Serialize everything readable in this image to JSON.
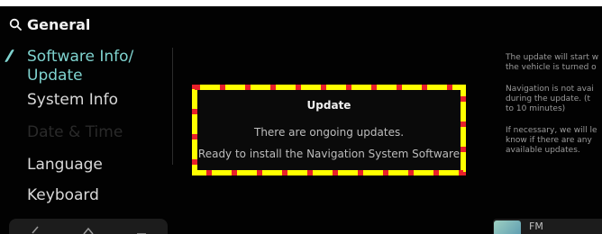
{
  "search": {
    "title": "General"
  },
  "menu": {
    "software": "Software Info/\nUpdate",
    "system": "System Info",
    "date": "Date & Time",
    "language": "Language",
    "keyboard": "Keyboard"
  },
  "dialog": {
    "title": "Update",
    "line1": "There are ongoing updates.",
    "line2": "Ready to install the Navigation System Software"
  },
  "info": {
    "p1": "The update will start w\nthe vehicle is turned o",
    "p2": "Navigation is not avai\nduring the update. (t\nto 10 minutes)",
    "p3": "If necessary, we will le\nknow if there are any\navailable updates."
  },
  "fm": {
    "label": "FM"
  },
  "colors": {
    "accent": "#7fd3cf",
    "highlight_border_yellow": "#ffff00",
    "highlight_border_red": "#e8202a"
  },
  "icons": [
    "search-icon",
    "back-icon",
    "home-icon",
    "menu-icon"
  ]
}
